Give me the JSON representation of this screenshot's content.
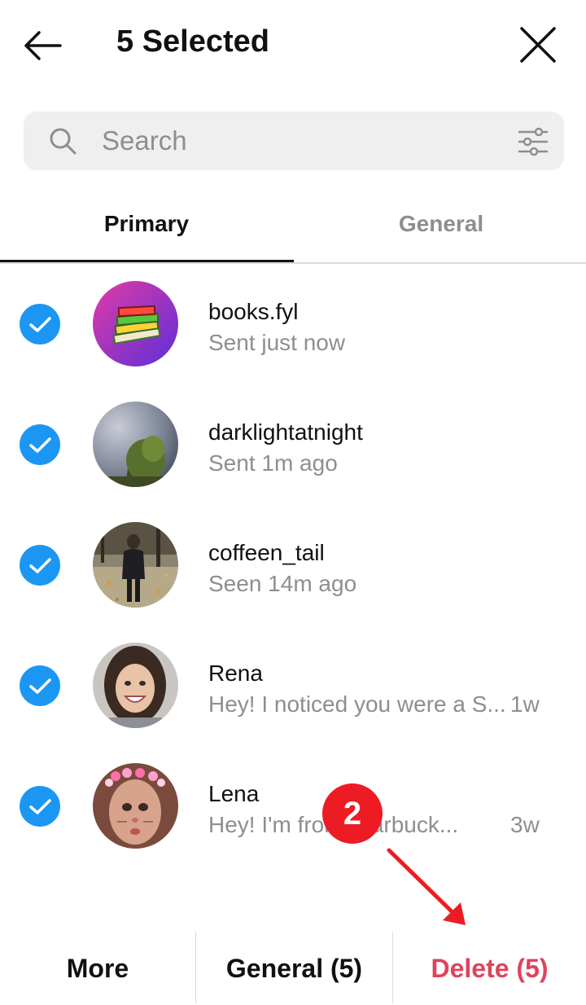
{
  "header": {
    "title": "5 Selected"
  },
  "search": {
    "placeholder": "Search"
  },
  "tabs": [
    {
      "label": "Primary",
      "active": true
    },
    {
      "label": "General",
      "active": false
    }
  ],
  "conversations": [
    {
      "name": "books.fyl",
      "preview": "Sent just now",
      "time": "",
      "selected": true
    },
    {
      "name": "darklightatnight",
      "preview": "Sent 1m ago",
      "time": "",
      "selected": true
    },
    {
      "name": "coffeen_tail",
      "preview": "Seen 14m ago",
      "time": "",
      "selected": true
    },
    {
      "name": "Rena",
      "preview": "Hey! I noticed you were a S...",
      "time": "1w",
      "selected": true
    },
    {
      "name": "Lena",
      "preview": "Hey! I'm from Starbuck...",
      "time": "3w",
      "selected": true
    }
  ],
  "bottom_bar": {
    "more": "More",
    "general": "General (5)",
    "delete": "Delete (5)"
  },
  "annotation": {
    "step": "2"
  },
  "colors": {
    "accent": "#1b97f3",
    "delete": "#e0435c",
    "annotation": "#ed1c24"
  }
}
